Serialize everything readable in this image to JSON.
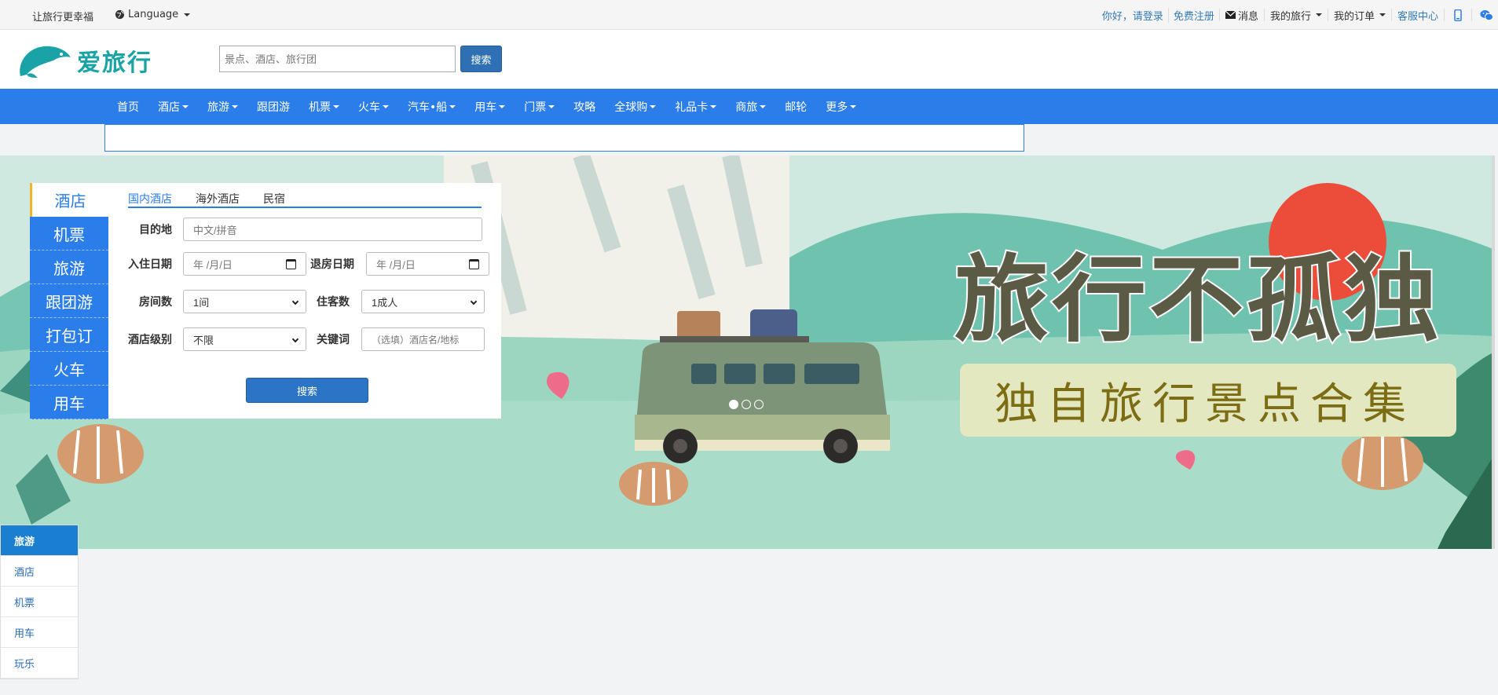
{
  "topbar": {
    "slogan": "让旅行更幸福",
    "language": "Language",
    "links": {
      "greeting": "你好，请登录",
      "register": "免费注册",
      "messages": "消息",
      "my_trips": "我的旅行",
      "my_orders": "我的订单",
      "service": "客服中心"
    }
  },
  "header": {
    "brand": "爱旅行",
    "search_placeholder": "景点、酒店、旅行团",
    "search_button": "搜索"
  },
  "nav": {
    "items": [
      {
        "label": "首页",
        "dropdown": false
      },
      {
        "label": "酒店",
        "dropdown": true
      },
      {
        "label": "旅游",
        "dropdown": true
      },
      {
        "label": "跟团游",
        "dropdown": false
      },
      {
        "label": "机票",
        "dropdown": true
      },
      {
        "label": "火车",
        "dropdown": true
      },
      {
        "label": "汽车•船",
        "dropdown": true
      },
      {
        "label": "用车",
        "dropdown": true
      },
      {
        "label": "门票",
        "dropdown": true
      },
      {
        "label": "攻略",
        "dropdown": false
      },
      {
        "label": "全球购",
        "dropdown": true
      },
      {
        "label": "礼品卡",
        "dropdown": true
      },
      {
        "label": "商旅",
        "dropdown": true
      },
      {
        "label": "邮轮",
        "dropdown": false
      },
      {
        "label": "更多",
        "dropdown": true
      }
    ]
  },
  "banner": {
    "headline": "旅行不孤独",
    "subheadline": "独自旅行景点合集",
    "slides_total": 3,
    "slide_active": 1
  },
  "booking": {
    "categories": [
      "酒店",
      "机票",
      "旅游",
      "跟团游",
      "打包订",
      "火车",
      "用车"
    ],
    "active_category": "酒店",
    "tabs": [
      "国内酒店",
      "海外酒店",
      "民宿"
    ],
    "labels": {
      "destination": "目的地",
      "checkin": "入住日期",
      "checkout": "退房日期",
      "rooms": "房间数",
      "guests": "住客数",
      "level": "酒店级别",
      "keyword": "关键词"
    },
    "destination_placeholder": "中文/拼音",
    "date_placeholder": "年 /月/日",
    "rooms_value": "1间",
    "guests_value": "1成人",
    "level_value": "不限",
    "keyword_placeholder": "（选填）酒店名/地标",
    "search_button": "搜索"
  },
  "floatmenu": {
    "title": "旅游",
    "items": [
      "酒店",
      "机票",
      "用车",
      "玩乐"
    ]
  },
  "colors": {
    "primary": "#2b7de9",
    "brand": "#1aa3a7",
    "link": "#337ab7"
  }
}
